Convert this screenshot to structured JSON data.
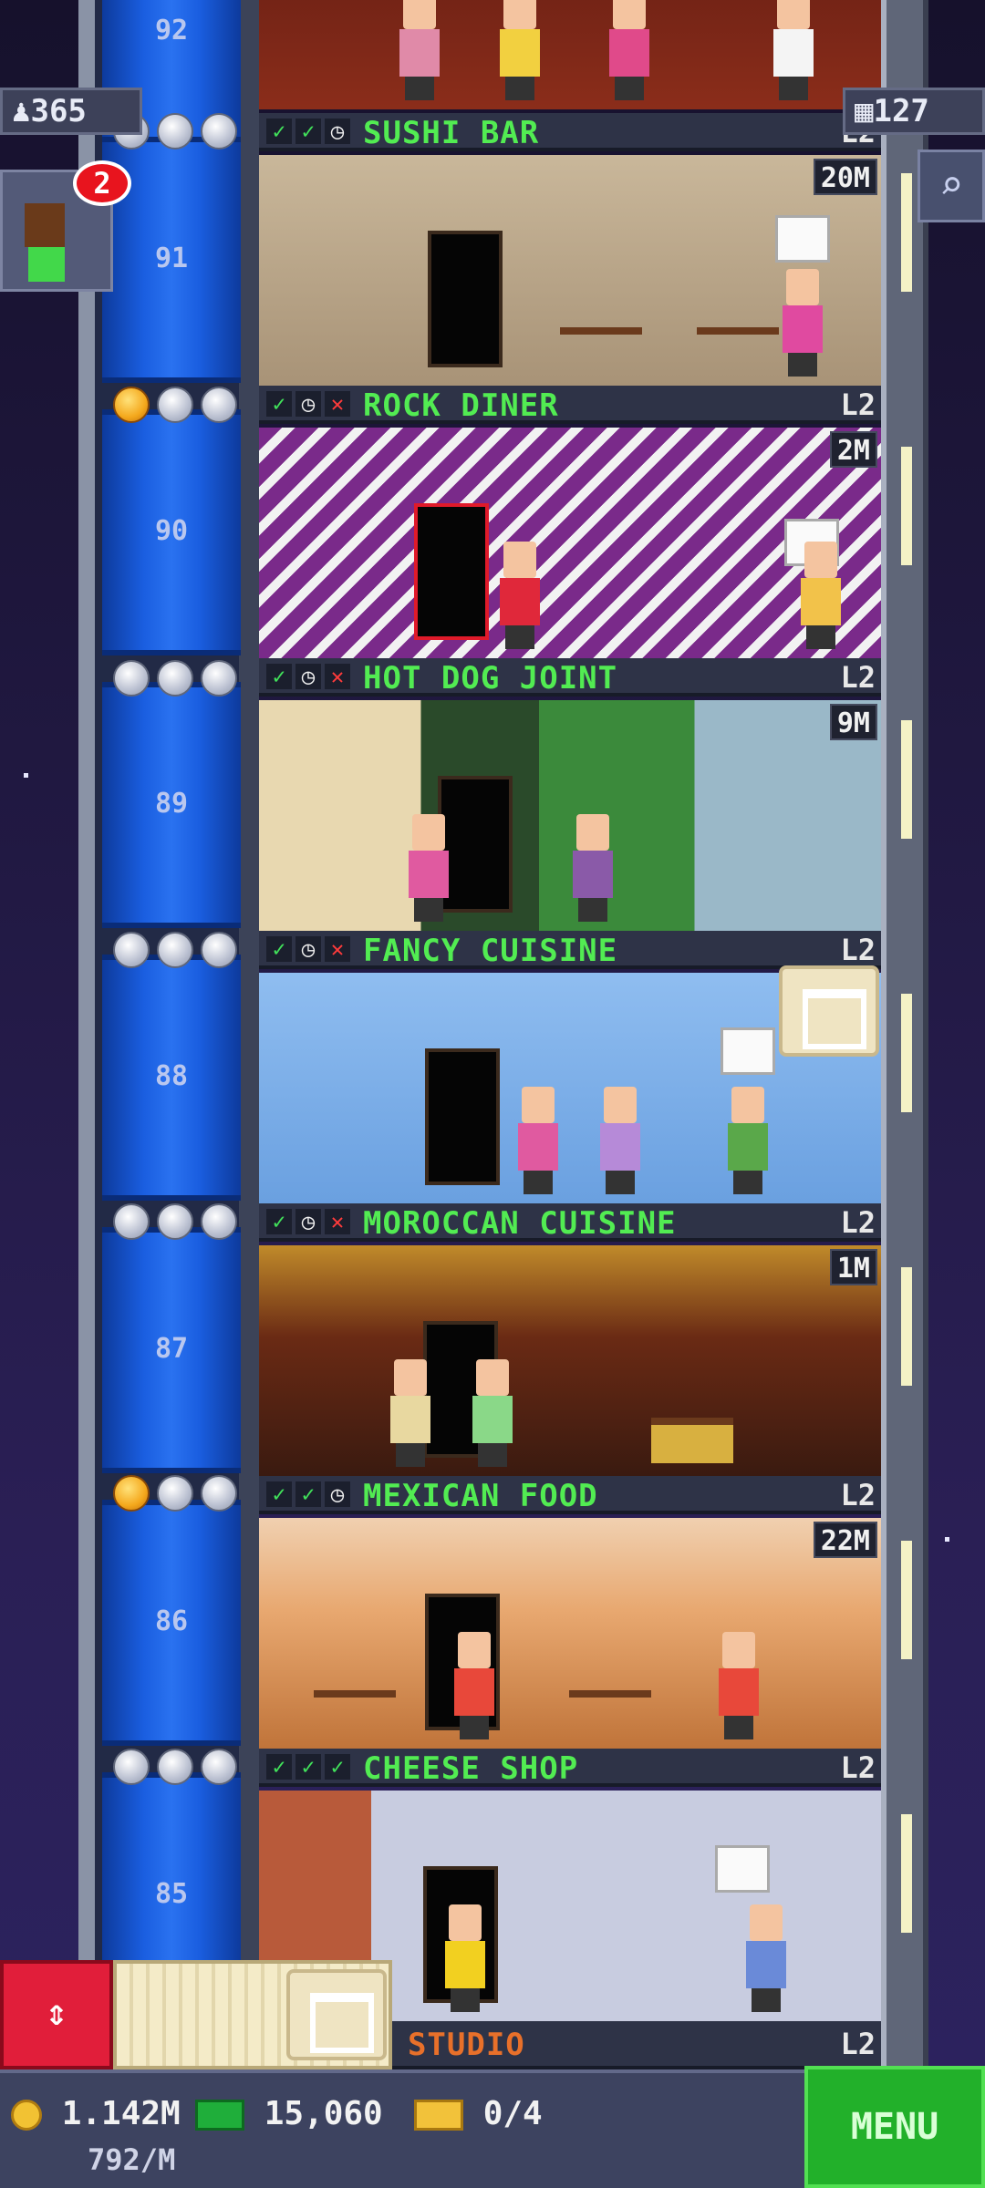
{
  "hud": {
    "population": "365",
    "floors": "127",
    "notification_count": "2"
  },
  "floors": [
    {
      "number": "92",
      "name": "",
      "level": "",
      "cash": "",
      "stars": ""
    },
    {
      "number": "91",
      "name": "SUSHI BAR",
      "level": "L2",
      "cash": "20M",
      "stars": "0",
      "checks": [
        "check",
        "check",
        "clock"
      ]
    },
    {
      "number": "90",
      "name": "ROCK DINER",
      "level": "L2",
      "cash": "2M",
      "stars": "1",
      "checks": [
        "check",
        "clock",
        "x"
      ]
    },
    {
      "number": "89",
      "name": "HOT DOG JOINT",
      "level": "L2",
      "cash": "9M",
      "stars": "0",
      "checks": [
        "check",
        "clock",
        "x"
      ]
    },
    {
      "number": "88",
      "name": "FANCY CUISINE",
      "level": "L2",
      "cash": "",
      "stars": "0",
      "checks": [
        "check",
        "clock",
        "x"
      ]
    },
    {
      "number": "87",
      "name": "MOROCCAN CUISINE",
      "level": "L2",
      "cash": "1M",
      "stars": "0",
      "checks": [
        "check",
        "clock",
        "x"
      ]
    },
    {
      "number": "86",
      "name": "MEXICAN FOOD",
      "level": "L2",
      "cash": "22M",
      "stars": "1",
      "checks": [
        "check",
        "check",
        "clock"
      ]
    },
    {
      "number": "85",
      "name": "CHEESE SHOP",
      "level": "L2",
      "cash": "",
      "stars": "0",
      "checks": [
        "check",
        "check",
        "check"
      ]
    }
  ],
  "partial_floor": {
    "name": "/ STUDIO",
    "level": "L2"
  },
  "bottom": {
    "coins": "1.142M",
    "coins_rate": "792/M",
    "bux": "15,060",
    "tickets": "0/4",
    "menu_label": "MENU"
  },
  "icons": {
    "population": "person-icon",
    "floors": "building-icon",
    "search": "magnifier-icon",
    "elevator": "up-down-arrows-icon",
    "crate": "crate-icon"
  },
  "colors": {
    "floor_name": "#52ec52",
    "elevator": "#1a5ee0",
    "menu": "#22b02a",
    "elevator_button": "#e11e3a"
  }
}
